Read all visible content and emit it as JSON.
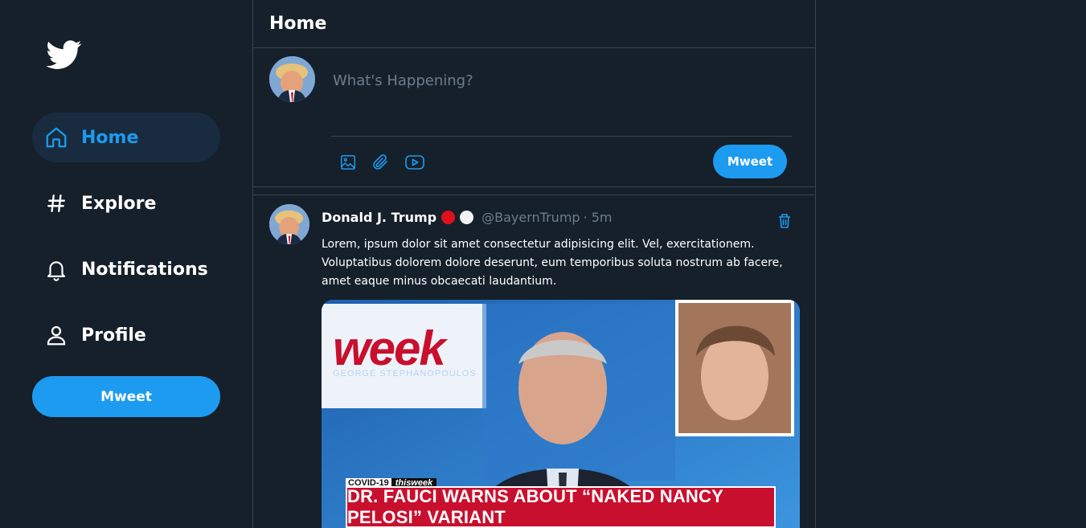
{
  "colors": {
    "background": "#15202b",
    "accent": "#1d9bf0",
    "border": "#38444d",
    "muted_text": "#6e7d8b",
    "active_nav_bg": "#192c3f"
  },
  "logo": {
    "icon": "twitter-bird-icon"
  },
  "sidebar": {
    "items": [
      {
        "label": "Home",
        "icon": "home-icon",
        "active": true
      },
      {
        "label": "Explore",
        "icon": "hashtag-icon",
        "active": false
      },
      {
        "label": "Notifications",
        "icon": "bell-icon",
        "active": false
      },
      {
        "label": "Profile",
        "icon": "user-icon",
        "active": false
      }
    ],
    "mweet_label": "Mweet"
  },
  "header": {
    "title": "Home"
  },
  "composer": {
    "placeholder": "What's Happening?",
    "tools": [
      "image-icon",
      "attachment-icon",
      "video-icon"
    ],
    "mweet_label": "Mweet"
  },
  "tweet": {
    "name": "Donald J. Trump",
    "badges": [
      "#e0101a",
      "#f2f2f2"
    ],
    "handle": "@BayernTrump",
    "time": "· 5m",
    "text": "Lorem, ipsum dolor sit amet consectetur adipisicing elit. Vel, exercitationem. Voluptatibus dolorem dolore deserunt, eum temporibus soluta nostrum ab facere, amet eaque minus obcaecati laudantium.",
    "media": {
      "show_title": "week",
      "show_subtitle": "GEORGE STEPHANOPOULOS",
      "tag_left": "COVID-19",
      "tag_right": "thisweek",
      "caption": "DR. FAUCI WARNS ABOUT “NAKED NANCY PELOSI” VARIANT"
    }
  }
}
